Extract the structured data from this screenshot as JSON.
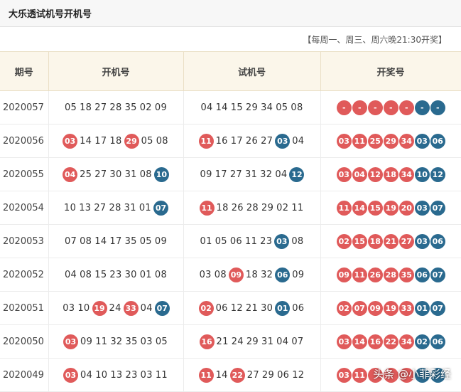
{
  "header": {
    "title": "大乐透试机号开机号"
  },
  "note": "【每周一、周三、周六晚21:30开奖】",
  "columns": [
    "期号",
    "开机号",
    "试机号",
    "开奖号"
  ],
  "colors": {
    "red": "#e05a5a",
    "blue": "#2a6a8f"
  },
  "rows": [
    {
      "period": "2020057",
      "kaiji": [
        {
          "n": "05"
        },
        {
          "n": "18"
        },
        {
          "n": "27"
        },
        {
          "n": "28"
        },
        {
          "n": "35"
        },
        {
          "n": "02"
        },
        {
          "n": "09"
        }
      ],
      "shiji": [
        {
          "n": "04"
        },
        {
          "n": "14"
        },
        {
          "n": "15"
        },
        {
          "n": "29"
        },
        {
          "n": "34"
        },
        {
          "n": "05"
        },
        {
          "n": "08"
        }
      ],
      "kaijiang": [
        {
          "n": "-",
          "c": "red"
        },
        {
          "n": "-",
          "c": "red"
        },
        {
          "n": "-",
          "c": "red"
        },
        {
          "n": "-",
          "c": "red"
        },
        {
          "n": "-",
          "c": "red"
        },
        {
          "n": "-",
          "c": "blue"
        },
        {
          "n": "-",
          "c": "blue"
        }
      ]
    },
    {
      "period": "2020056",
      "kaiji": [
        {
          "n": "03",
          "c": "red"
        },
        {
          "n": "14"
        },
        {
          "n": "17"
        },
        {
          "n": "18"
        },
        {
          "n": "29",
          "c": "red"
        },
        {
          "n": "05"
        },
        {
          "n": "08"
        }
      ],
      "shiji": [
        {
          "n": "11",
          "c": "red"
        },
        {
          "n": "16"
        },
        {
          "n": "17"
        },
        {
          "n": "26"
        },
        {
          "n": "27"
        },
        {
          "n": "03",
          "c": "blue"
        },
        {
          "n": "04"
        }
      ],
      "kaijiang": [
        {
          "n": "03",
          "c": "red"
        },
        {
          "n": "11",
          "c": "red"
        },
        {
          "n": "25",
          "c": "red"
        },
        {
          "n": "29",
          "c": "red"
        },
        {
          "n": "34",
          "c": "red"
        },
        {
          "n": "03",
          "c": "blue"
        },
        {
          "n": "06",
          "c": "blue"
        }
      ]
    },
    {
      "period": "2020055",
      "kaiji": [
        {
          "n": "04",
          "c": "red"
        },
        {
          "n": "25"
        },
        {
          "n": "27"
        },
        {
          "n": "30"
        },
        {
          "n": "31"
        },
        {
          "n": "08"
        },
        {
          "n": "10",
          "c": "blue"
        }
      ],
      "shiji": [
        {
          "n": "09"
        },
        {
          "n": "17"
        },
        {
          "n": "27"
        },
        {
          "n": "31"
        },
        {
          "n": "32"
        },
        {
          "n": "04"
        },
        {
          "n": "12",
          "c": "blue"
        }
      ],
      "kaijiang": [
        {
          "n": "03",
          "c": "red"
        },
        {
          "n": "04",
          "c": "red"
        },
        {
          "n": "12",
          "c": "red"
        },
        {
          "n": "18",
          "c": "red"
        },
        {
          "n": "34",
          "c": "red"
        },
        {
          "n": "10",
          "c": "blue"
        },
        {
          "n": "12",
          "c": "blue"
        }
      ]
    },
    {
      "period": "2020054",
      "kaiji": [
        {
          "n": "10"
        },
        {
          "n": "13"
        },
        {
          "n": "27"
        },
        {
          "n": "28"
        },
        {
          "n": "31"
        },
        {
          "n": "01"
        },
        {
          "n": "07",
          "c": "blue"
        }
      ],
      "shiji": [
        {
          "n": "11",
          "c": "red"
        },
        {
          "n": "18"
        },
        {
          "n": "26"
        },
        {
          "n": "28"
        },
        {
          "n": "29"
        },
        {
          "n": "02"
        },
        {
          "n": "11"
        }
      ],
      "kaijiang": [
        {
          "n": "11",
          "c": "red"
        },
        {
          "n": "14",
          "c": "red"
        },
        {
          "n": "15",
          "c": "red"
        },
        {
          "n": "19",
          "c": "red"
        },
        {
          "n": "20",
          "c": "red"
        },
        {
          "n": "03",
          "c": "blue"
        },
        {
          "n": "07",
          "c": "blue"
        }
      ]
    },
    {
      "period": "2020053",
      "kaiji": [
        {
          "n": "07"
        },
        {
          "n": "08"
        },
        {
          "n": "14"
        },
        {
          "n": "17"
        },
        {
          "n": "35"
        },
        {
          "n": "05"
        },
        {
          "n": "09"
        }
      ],
      "shiji": [
        {
          "n": "01"
        },
        {
          "n": "05"
        },
        {
          "n": "06"
        },
        {
          "n": "11"
        },
        {
          "n": "23"
        },
        {
          "n": "03",
          "c": "blue"
        },
        {
          "n": "08"
        }
      ],
      "kaijiang": [
        {
          "n": "02",
          "c": "red"
        },
        {
          "n": "15",
          "c": "red"
        },
        {
          "n": "18",
          "c": "red"
        },
        {
          "n": "21",
          "c": "red"
        },
        {
          "n": "27",
          "c": "red"
        },
        {
          "n": "03",
          "c": "blue"
        },
        {
          "n": "06",
          "c": "blue"
        }
      ]
    },
    {
      "period": "2020052",
      "kaiji": [
        {
          "n": "04"
        },
        {
          "n": "08"
        },
        {
          "n": "15"
        },
        {
          "n": "23"
        },
        {
          "n": "30"
        },
        {
          "n": "01"
        },
        {
          "n": "08"
        }
      ],
      "shiji": [
        {
          "n": "03"
        },
        {
          "n": "08"
        },
        {
          "n": "09",
          "c": "red"
        },
        {
          "n": "18"
        },
        {
          "n": "32"
        },
        {
          "n": "06",
          "c": "blue"
        },
        {
          "n": "09"
        }
      ],
      "kaijiang": [
        {
          "n": "09",
          "c": "red"
        },
        {
          "n": "11",
          "c": "red"
        },
        {
          "n": "26",
          "c": "red"
        },
        {
          "n": "28",
          "c": "red"
        },
        {
          "n": "35",
          "c": "red"
        },
        {
          "n": "06",
          "c": "blue"
        },
        {
          "n": "07",
          "c": "blue"
        }
      ]
    },
    {
      "period": "2020051",
      "kaiji": [
        {
          "n": "03"
        },
        {
          "n": "10"
        },
        {
          "n": "19",
          "c": "red"
        },
        {
          "n": "24"
        },
        {
          "n": "33",
          "c": "red"
        },
        {
          "n": "04"
        },
        {
          "n": "07",
          "c": "blue"
        }
      ],
      "shiji": [
        {
          "n": "02",
          "c": "red"
        },
        {
          "n": "06"
        },
        {
          "n": "12"
        },
        {
          "n": "21"
        },
        {
          "n": "30"
        },
        {
          "n": "01",
          "c": "blue"
        },
        {
          "n": "06"
        }
      ],
      "kaijiang": [
        {
          "n": "02",
          "c": "red"
        },
        {
          "n": "07",
          "c": "red"
        },
        {
          "n": "09",
          "c": "red"
        },
        {
          "n": "19",
          "c": "red"
        },
        {
          "n": "33",
          "c": "red"
        },
        {
          "n": "01",
          "c": "blue"
        },
        {
          "n": "07",
          "c": "blue"
        }
      ]
    },
    {
      "period": "2020050",
      "kaiji": [
        {
          "n": "03",
          "c": "red"
        },
        {
          "n": "09"
        },
        {
          "n": "11"
        },
        {
          "n": "32"
        },
        {
          "n": "35"
        },
        {
          "n": "03"
        },
        {
          "n": "05"
        }
      ],
      "shiji": [
        {
          "n": "16",
          "c": "red"
        },
        {
          "n": "21"
        },
        {
          "n": "24"
        },
        {
          "n": "29"
        },
        {
          "n": "31"
        },
        {
          "n": "04"
        },
        {
          "n": "07"
        }
      ],
      "kaijiang": [
        {
          "n": "03",
          "c": "red"
        },
        {
          "n": "14",
          "c": "red"
        },
        {
          "n": "16",
          "c": "red"
        },
        {
          "n": "22",
          "c": "red"
        },
        {
          "n": "34",
          "c": "red"
        },
        {
          "n": "02",
          "c": "blue"
        },
        {
          "n": "06",
          "c": "blue"
        }
      ]
    },
    {
      "period": "2020049",
      "kaiji": [
        {
          "n": "03",
          "c": "red"
        },
        {
          "n": "04"
        },
        {
          "n": "10"
        },
        {
          "n": "13"
        },
        {
          "n": "23"
        },
        {
          "n": "03"
        },
        {
          "n": "11"
        }
      ],
      "shiji": [
        {
          "n": "11",
          "c": "red"
        },
        {
          "n": "14"
        },
        {
          "n": "22",
          "c": "red"
        },
        {
          "n": "27"
        },
        {
          "n": "29"
        },
        {
          "n": "06"
        },
        {
          "n": "12"
        }
      ],
      "kaijiang": [
        {
          "n": "03",
          "c": "red"
        },
        {
          "n": "11",
          "c": "red"
        },
        {
          "n": "",
          "c": "red"
        },
        {
          "n": "",
          "c": "red"
        },
        {
          "n": "",
          "c": "red"
        },
        {
          "n": "",
          "c": "blue"
        },
        {
          "n": "",
          "c": "blue"
        }
      ]
    }
  ],
  "watermark": "头条 @小菲彩经"
}
